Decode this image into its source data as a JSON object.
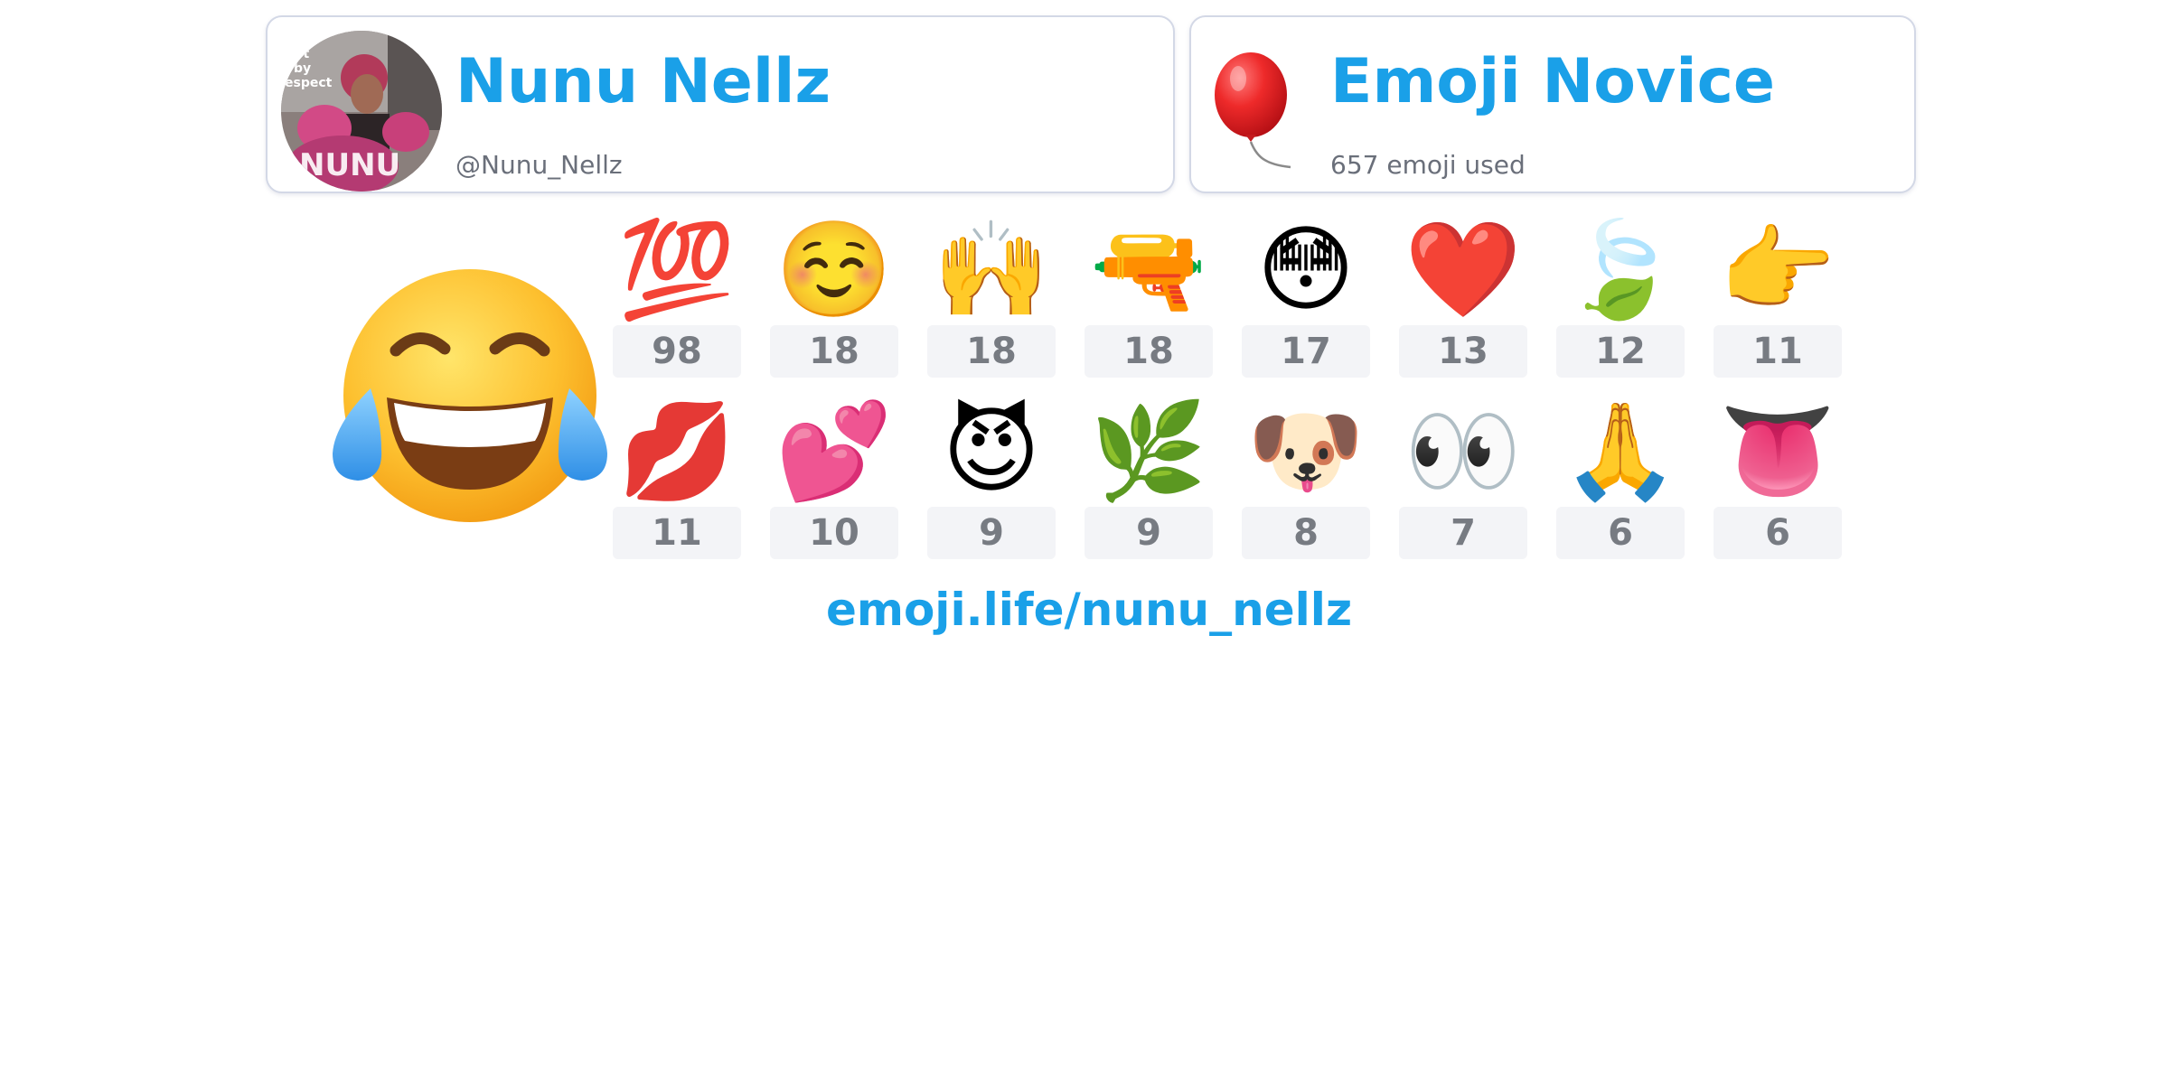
{
  "user": {
    "display_name": "Nunu Nellz",
    "handle": "@Nunu_Nellz"
  },
  "badge": {
    "rank": "Emoji Novice",
    "emoji_used": "657 emoji used",
    "icon": "balloon-icon"
  },
  "top_emoji": {
    "icon": "face-with-tears-of-joy-icon",
    "glyph": "😂"
  },
  "emoji_counts": [
    {
      "icon": "hundred-points-icon",
      "glyph": "💯",
      "count": "98"
    },
    {
      "icon": "smiling-face-icon",
      "glyph": "☺️",
      "count": "18"
    },
    {
      "icon": "raising-hands-icon",
      "glyph": "🙌",
      "count": "18"
    },
    {
      "icon": "water-pistol-icon",
      "glyph": "🔫",
      "count": "18"
    },
    {
      "icon": "flushed-face-icon",
      "glyph": "😳",
      "count": "17"
    },
    {
      "icon": "red-heart-icon",
      "glyph": "❤️",
      "count": "13"
    },
    {
      "icon": "leaf-fluttering-icon",
      "glyph": "🍃",
      "count": "12"
    },
    {
      "icon": "pointing-right-icon",
      "glyph": "👉",
      "count": "11"
    },
    {
      "icon": "kiss-mark-icon",
      "glyph": "💋",
      "count": "11"
    },
    {
      "icon": "two-hearts-icon",
      "glyph": "💕",
      "count": "10"
    },
    {
      "icon": "smiling-face-with-horns-icon",
      "glyph": "😈",
      "count": "9"
    },
    {
      "icon": "herb-icon",
      "glyph": "🌿",
      "count": "9"
    },
    {
      "icon": "dog-face-icon",
      "glyph": "🐶",
      "count": "8"
    },
    {
      "icon": "eyes-icon",
      "glyph": "👀",
      "count": "7"
    },
    {
      "icon": "folded-hands-icon",
      "glyph": "🙏",
      "count": "6"
    },
    {
      "icon": "tongue-icon",
      "glyph": "👅",
      "count": "6"
    }
  ],
  "footer": {
    "profile_url": "emoji.life/nunu_nellz"
  }
}
